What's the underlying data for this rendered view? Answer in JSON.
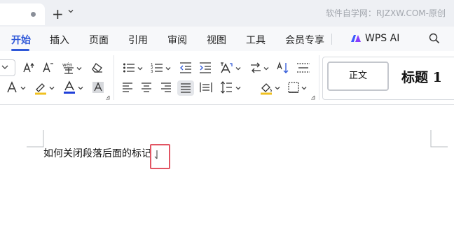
{
  "tab_strip": {
    "doc_tab_state": "modified-dot",
    "new_tab_symbol": "+",
    "watermark": "软件自学网：RJZXW.COM-原创"
  },
  "menu": {
    "items": [
      "开始",
      "插入",
      "页面",
      "引用",
      "审阅",
      "视图",
      "工具",
      "会员专享"
    ],
    "active": "开始",
    "ai_label": "WPS AI",
    "accent_color": "#2f58d8"
  },
  "ribbon": {
    "font_group_icons": [
      "font-name-dropdown-icon",
      "grow-font-icon",
      "shrink-font-icon",
      "phonetic-guide-icon",
      "clear-format-icon",
      "text-effect-icon",
      "highlight-color-icon",
      "font-color-icon",
      "character-shading-icon"
    ],
    "paragraph_group_icons": [
      "bullets-icon",
      "numbering-icon",
      "decrease-indent-icon",
      "increase-indent-icon",
      "change-case-icon",
      "text-direction-icon",
      "sort-icon",
      "show-marks-icon",
      "align-left-icon",
      "align-center-icon",
      "align-right-icon",
      "justify-icon",
      "distributed-icon",
      "line-spacing-icon",
      "shading-icon",
      "borders-icon"
    ],
    "font_color": "#1f3fd8",
    "styles": {
      "normal": "正文",
      "heading1": "标题 1"
    }
  },
  "document": {
    "text": "如何关闭段落后面的标记",
    "annotation_color": "#e25563"
  }
}
